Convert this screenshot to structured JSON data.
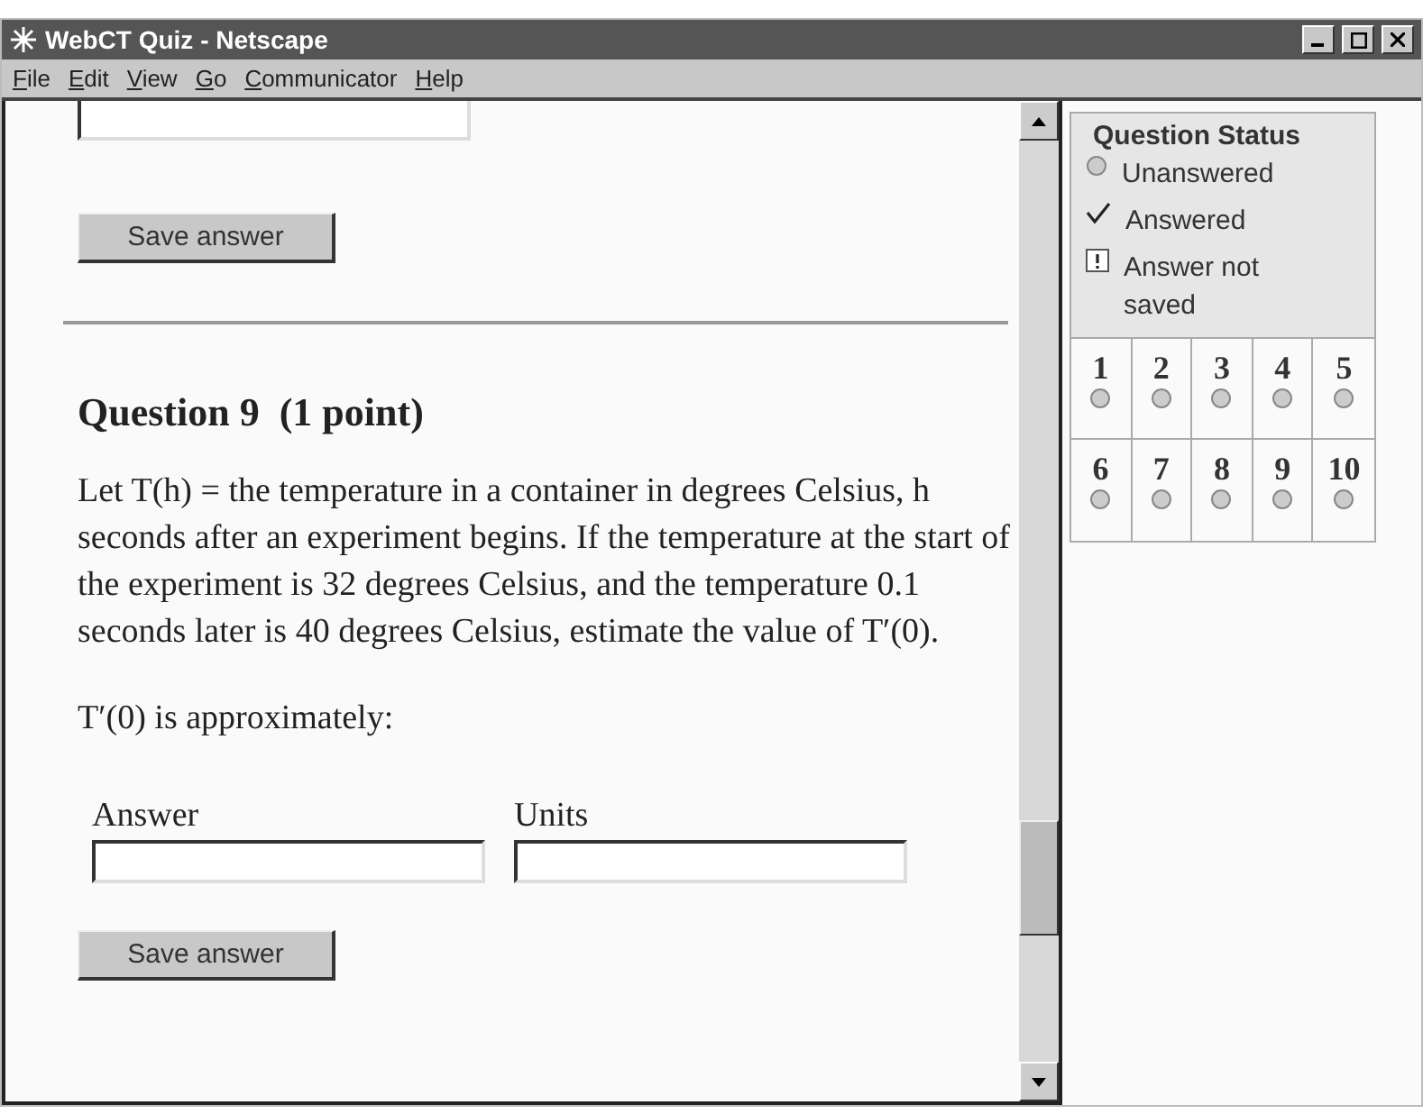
{
  "window": {
    "title": "WebCT Quiz - Netscape"
  },
  "menu": [
    "File",
    "Edit",
    "View",
    "Go",
    "Communicator",
    "Help"
  ],
  "previous_question": {
    "save_button": "Save answer"
  },
  "question": {
    "title": "Question 9",
    "points": "(1 point)",
    "text": "Let T(h) = the temperature in a container in degrees Celsius, h seconds after an experiment begins. If the temperature at the start of the experiment is 32 degrees Celsius, and the temperature 0.1 seconds later is 40 degrees Celsius, estimate the value of T′(0).",
    "prompt": "T′(0) is approximately:",
    "fields": [
      {
        "label": "Answer"
      },
      {
        "label": "Units"
      }
    ],
    "save_button": "Save answer"
  },
  "status_panel": {
    "title": "Question Status",
    "legend": [
      {
        "kind": "unanswered",
        "label": "Unanswered"
      },
      {
        "kind": "answered",
        "label": "Answered"
      },
      {
        "kind": "unsaved",
        "label": "Answer not saved"
      }
    ],
    "questions": [
      {
        "number": "1",
        "kind": "unanswered"
      },
      {
        "number": "2",
        "kind": "unanswered"
      },
      {
        "number": "3",
        "kind": "unanswered"
      },
      {
        "number": "4",
        "kind": "unanswered"
      },
      {
        "number": "5",
        "kind": "unanswered"
      },
      {
        "number": "6",
        "kind": "unanswered"
      },
      {
        "number": "7",
        "kind": "unanswered"
      },
      {
        "number": "8",
        "kind": "unanswered"
      },
      {
        "number": "9",
        "kind": "unanswered"
      },
      {
        "number": "10",
        "kind": "unanswered"
      }
    ]
  }
}
